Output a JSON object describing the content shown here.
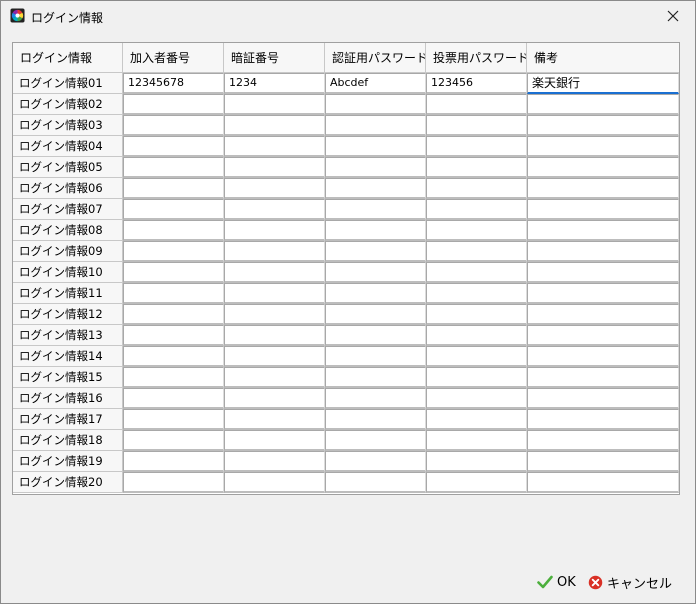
{
  "window": {
    "title": "ログイン情報"
  },
  "grid": {
    "headers": [
      "ログイン情報",
      "加入者番号",
      "暗証番号",
      "認証用パスワード",
      "投票用パスワード",
      "備考"
    ],
    "rows": [
      {
        "label": "ログイン情報01",
        "values": [
          "12345678",
          "1234",
          "Abcdef",
          "123456",
          "楽天銀行"
        ]
      },
      {
        "label": "ログイン情報02",
        "values": [
          "",
          "",
          "",
          "",
          ""
        ]
      },
      {
        "label": "ログイン情報03",
        "values": [
          "",
          "",
          "",
          "",
          ""
        ]
      },
      {
        "label": "ログイン情報04",
        "values": [
          "",
          "",
          "",
          "",
          ""
        ]
      },
      {
        "label": "ログイン情報05",
        "values": [
          "",
          "",
          "",
          "",
          ""
        ]
      },
      {
        "label": "ログイン情報06",
        "values": [
          "",
          "",
          "",
          "",
          ""
        ]
      },
      {
        "label": "ログイン情報07",
        "values": [
          "",
          "",
          "",
          "",
          ""
        ]
      },
      {
        "label": "ログイン情報08",
        "values": [
          "",
          "",
          "",
          "",
          ""
        ]
      },
      {
        "label": "ログイン情報09",
        "values": [
          "",
          "",
          "",
          "",
          ""
        ]
      },
      {
        "label": "ログイン情報10",
        "values": [
          "",
          "",
          "",
          "",
          ""
        ]
      },
      {
        "label": "ログイン情報11",
        "values": [
          "",
          "",
          "",
          "",
          ""
        ]
      },
      {
        "label": "ログイン情報12",
        "values": [
          "",
          "",
          "",
          "",
          ""
        ]
      },
      {
        "label": "ログイン情報13",
        "values": [
          "",
          "",
          "",
          "",
          ""
        ]
      },
      {
        "label": "ログイン情報14",
        "values": [
          "",
          "",
          "",
          "",
          ""
        ]
      },
      {
        "label": "ログイン情報15",
        "values": [
          "",
          "",
          "",
          "",
          ""
        ]
      },
      {
        "label": "ログイン情報16",
        "values": [
          "",
          "",
          "",
          "",
          ""
        ]
      },
      {
        "label": "ログイン情報17",
        "values": [
          "",
          "",
          "",
          "",
          ""
        ]
      },
      {
        "label": "ログイン情報18",
        "values": [
          "",
          "",
          "",
          "",
          ""
        ]
      },
      {
        "label": "ログイン情報19",
        "values": [
          "",
          "",
          "",
          "",
          ""
        ]
      },
      {
        "label": "ログイン情報20",
        "values": [
          "",
          "",
          "",
          "",
          ""
        ]
      }
    ]
  },
  "buttons": {
    "ok_label": "OK",
    "cancel_label": "キャンセル"
  },
  "icons": {
    "app": "color-wheel-icon",
    "close": "close-icon",
    "ok": "checkmark-icon",
    "cancel": "cancel-circle-icon"
  },
  "colors": {
    "ok_check": "#4caf3c",
    "cancel_red": "#d93025",
    "focus_underline": "#1a6fd1"
  }
}
